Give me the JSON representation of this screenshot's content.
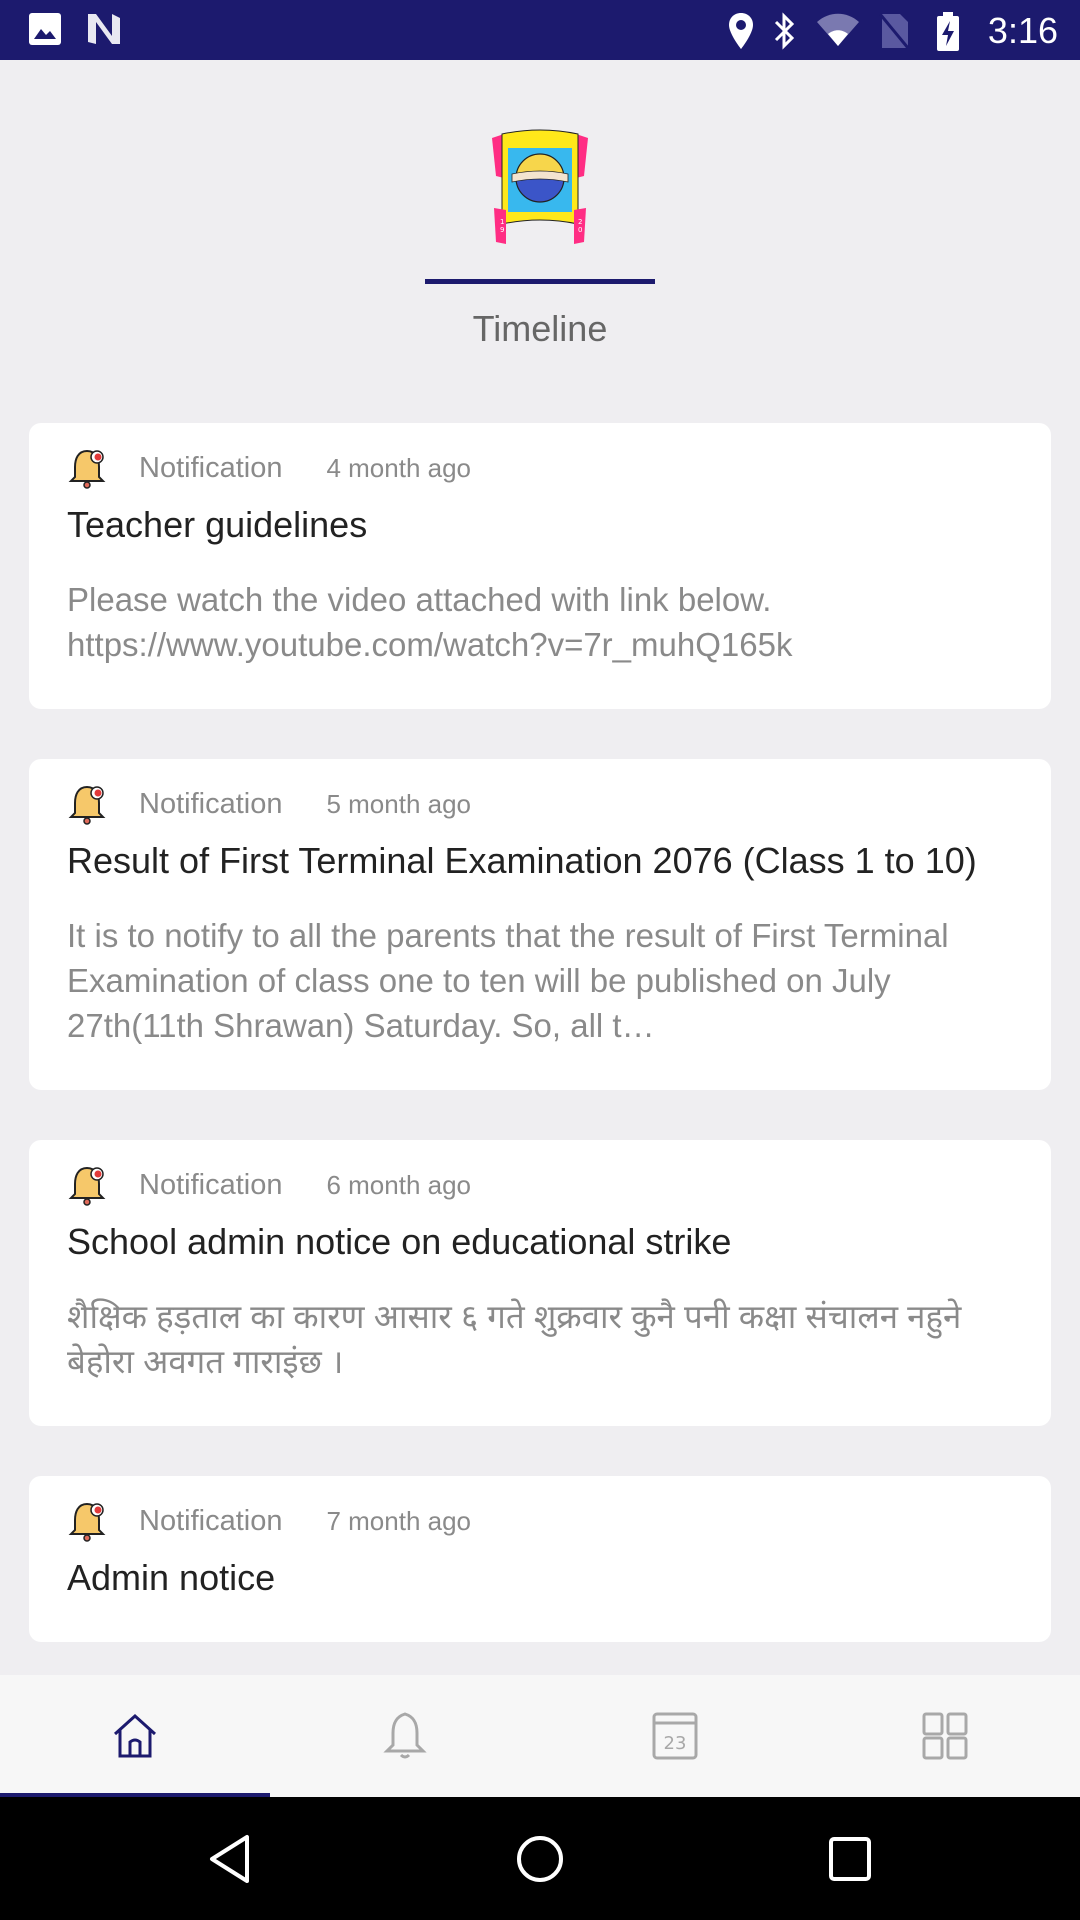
{
  "status_bar": {
    "time": "3:16",
    "left_icons": [
      "image-icon",
      "n-logo-icon"
    ],
    "right_icons": [
      "location-icon",
      "bluetooth-icon",
      "wifi-icon",
      "no-sim-icon",
      "battery-charging-icon"
    ]
  },
  "header": {
    "logo_alt": "School logo 1995 2052",
    "active_tab": "Timeline"
  },
  "feed": {
    "items": [
      {
        "type": "Notification",
        "time": "4 month ago",
        "title": "Teacher guidelines",
        "body": "Please watch the video attached with link below. https://www.youtube.com/watch?v=7r_muhQ165k"
      },
      {
        "type": "Notification",
        "time": "5 month ago",
        "title": "Result of First Terminal Examination 2076 (Class 1 to 10)",
        "body": "It is to notify to all the parents that the result of First Terminal Examination of class one to ten will be published on July 27th(11th Shrawan) Saturday. So, all t…"
      },
      {
        "type": "Notification",
        "time": "6 month ago",
        "title": "School admin notice on educational strike",
        "body": "शैक्षिक हड़ताल का कारण आसार ६ गते शुक्रवार कुनै पनी कक्षा संचालन नहुने बेहोरा अवगत गाराइंछ ।"
      },
      {
        "type": "Notification",
        "time": "7 month ago",
        "title": "Admin notice",
        "body": ""
      }
    ]
  },
  "bottom_nav": {
    "items": [
      {
        "name": "home",
        "icon": "home-icon",
        "active": true
      },
      {
        "name": "notifications",
        "icon": "bell-icon",
        "active": false
      },
      {
        "name": "calendar",
        "icon": "calendar-icon",
        "calendar_day": "23",
        "active": false
      },
      {
        "name": "menu",
        "icon": "grid-icon",
        "active": false
      }
    ]
  },
  "colors": {
    "primary": "#1c1a6e",
    "background": "#efeef1",
    "card": "#ffffff",
    "muted_text": "#8a8a8a",
    "title_text": "#222222",
    "inactive_icon": "#a8a8a8"
  }
}
